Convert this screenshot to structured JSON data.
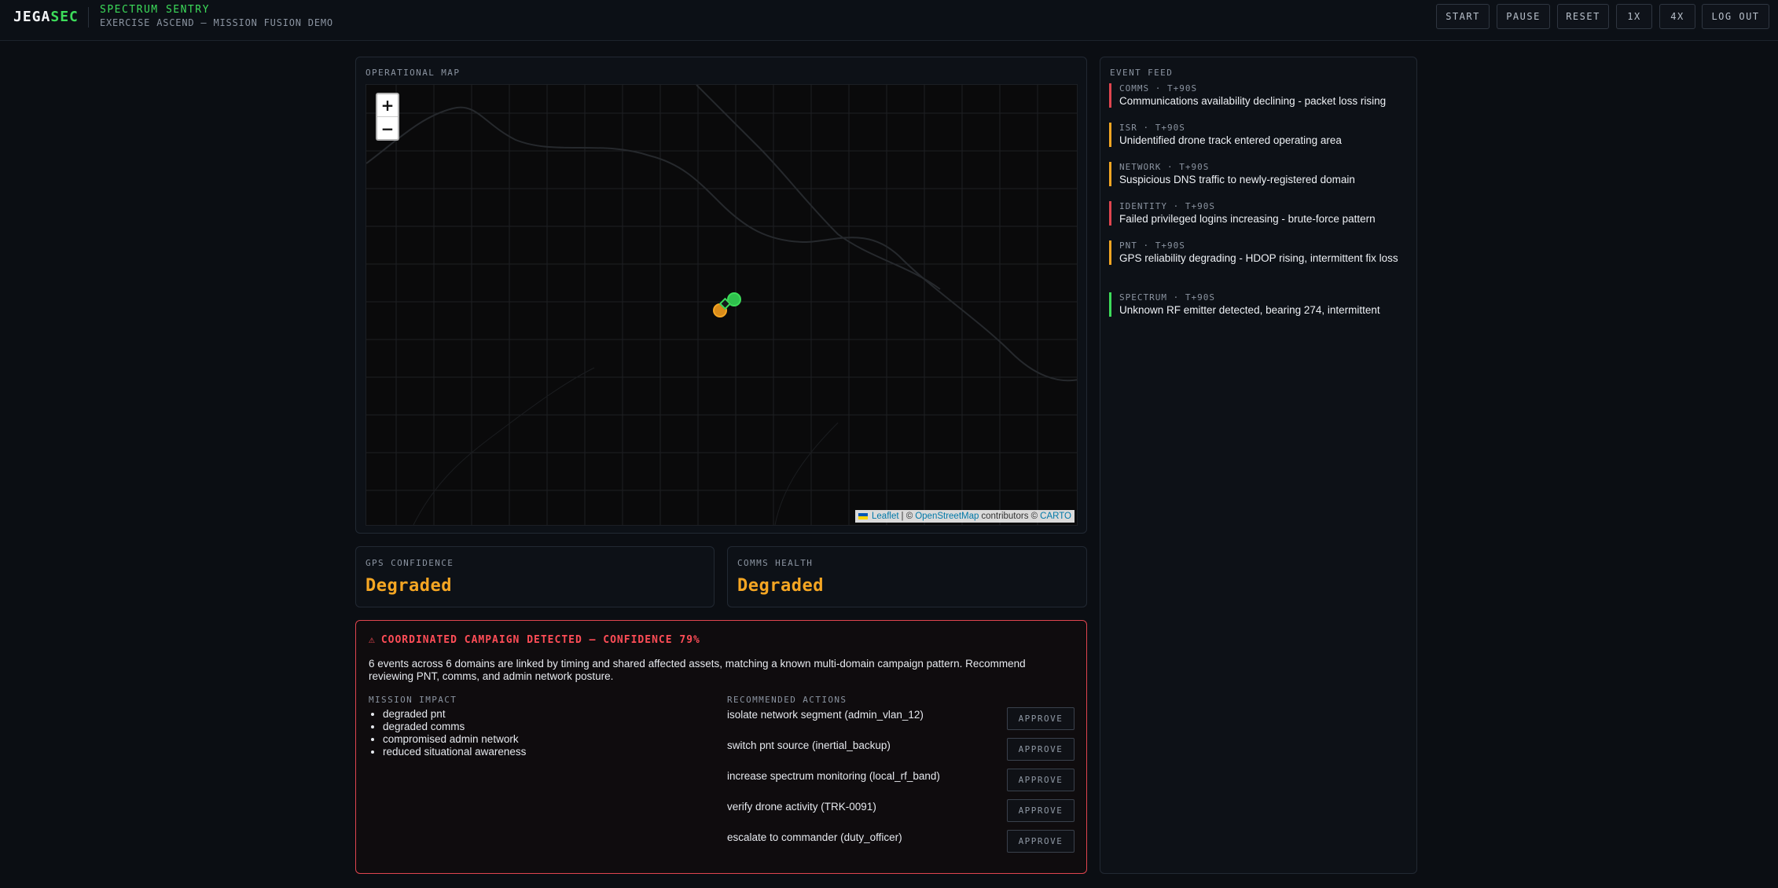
{
  "header": {
    "logo_main": "JEGA",
    "logo_accent": "SEC",
    "title": "SPECTRUM SENTRY",
    "subtitle": "EXERCISE ASCEND — MISSION FUSION DEMO",
    "buttons": {
      "start": "START",
      "pause": "PAUSE",
      "reset": "RESET",
      "speed_1x": "1X",
      "speed_4x": "4X",
      "logout": "LOG OUT"
    }
  },
  "map": {
    "label": "OPERATIONAL MAP",
    "zoom_in": "+",
    "zoom_out": "−",
    "attribution": {
      "leaflet": "Leaflet",
      "sep": "| ©",
      "osm": "OpenStreetMap",
      "contrib": "contributors ©",
      "carto": "CARTO"
    },
    "markers": [
      {
        "name": "asset-marker",
        "color": "#3ddc5a"
      },
      {
        "name": "threat-marker",
        "color": "#f5a623"
      }
    ]
  },
  "stats": {
    "gps": {
      "label": "GPS CONFIDENCE",
      "value": "Degraded"
    },
    "comms": {
      "label": "COMMS HEALTH",
      "value": "Degraded"
    }
  },
  "alert": {
    "icon": "⚠",
    "title": "COORDINATED CAMPAIGN DETECTED — CONFIDENCE 79%",
    "description": "6 events across 6 domains are linked by timing and shared affected assets, matching a known multi-domain campaign pattern. Recommend reviewing PNT, comms, and admin network posture.",
    "impact_label": "MISSION IMPACT",
    "impacts": [
      "degraded pnt",
      "degraded comms",
      "compromised admin network",
      "reduced situational awareness"
    ],
    "actions_label": "RECOMMENDED ACTIONS",
    "approve_label": "APPROVE",
    "actions": [
      "isolate network segment (admin_vlan_12)",
      "switch pnt source (inertial_backup)",
      "increase spectrum monitoring (local_rf_band)",
      "verify drone activity (TRK-0091)",
      "escalate to commander (duty_officer)"
    ]
  },
  "feed": {
    "label": "EVENT FEED",
    "events": [
      {
        "meta": "COMMS · T+90S",
        "text": "Communications availability declining - packet loss rising",
        "color": "#e0454f"
      },
      {
        "meta": "ISR · T+90S",
        "text": "Unidentified drone track entered operating area",
        "color": "#f5a623"
      },
      {
        "meta": "NETWORK · T+90S",
        "text": "Suspicious DNS traffic to newly-registered domain",
        "color": "#f5a623"
      },
      {
        "meta": "IDENTITY · T+90S",
        "text": "Failed privileged logins increasing - brute-force pattern",
        "color": "#e0454f"
      },
      {
        "meta": "PNT · T+90S",
        "text": "GPS reliability degrading - HDOP rising, intermittent fix loss",
        "color": "#f5a623"
      },
      {
        "meta": "SPECTRUM · T+90S",
        "text": "Unknown RF emitter detected, bearing 274, intermittent",
        "color": "#3ddc5a"
      }
    ]
  }
}
